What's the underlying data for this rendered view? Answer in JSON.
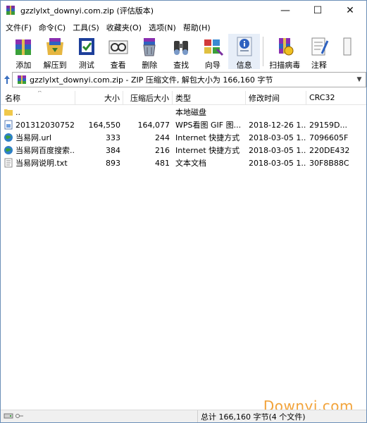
{
  "window": {
    "title": "gzzlylxt_downyi.com.zip (评估版本)",
    "controls": {
      "minimize": "—",
      "maximize": "☐",
      "close": "✕"
    }
  },
  "menu": [
    "文件(F)",
    "命令(C)",
    "工具(S)",
    "收藏夹(O)",
    "选项(N)",
    "帮助(H)"
  ],
  "toolbar": [
    {
      "label": "添加",
      "icon": "add-archive-icon"
    },
    {
      "label": "解压到",
      "icon": "extract-to-icon"
    },
    {
      "label": "测试",
      "icon": "test-icon"
    },
    {
      "label": "查看",
      "icon": "view-icon"
    },
    {
      "label": "删除",
      "icon": "delete-icon"
    },
    {
      "label": "查找",
      "icon": "find-icon"
    },
    {
      "label": "向导",
      "icon": "wizard-icon"
    },
    {
      "label": "信息",
      "icon": "info-icon"
    },
    {
      "label": "扫描病毒",
      "icon": "virus-scan-icon"
    },
    {
      "label": "注释",
      "icon": "comment-icon"
    }
  ],
  "address": {
    "text": "gzzlylxt_downyi.com.zip - ZIP 压缩文件, 解包大小为 166,160 字节"
  },
  "columns": {
    "name": "名称",
    "size": "大小",
    "packed": "压缩后大小",
    "type": "类型",
    "modified": "修改时间",
    "crc": "CRC32"
  },
  "files": [
    {
      "name": "..",
      "size": "",
      "packed": "",
      "type": "本地磁盘",
      "modified": "",
      "crc": "",
      "icon": "folder-up-icon"
    },
    {
      "name": "201312030752...",
      "size": "164,550",
      "packed": "164,077",
      "type": "WPS看图 GIF 图...",
      "modified": "2018-12-26 1...",
      "crc": "29159D...",
      "icon": "image-file-icon"
    },
    {
      "name": "当易网.url",
      "size": "333",
      "packed": "244",
      "type": "Internet 快捷方式",
      "modified": "2018-03-05 1...",
      "crc": "7096605F",
      "icon": "internet-shortcut-icon"
    },
    {
      "name": "当易网百度搜索....",
      "size": "384",
      "packed": "216",
      "type": "Internet 快捷方式",
      "modified": "2018-03-05 1...",
      "crc": "220DE432",
      "icon": "internet-shortcut-icon"
    },
    {
      "name": "当易网说明.txt",
      "size": "893",
      "packed": "481",
      "type": "文本文档",
      "modified": "2018-03-05 1...",
      "crc": "30F8B88C",
      "icon": "text-file-icon"
    }
  ],
  "status": {
    "text": "总计 166,160 字节(4 个文件)"
  },
  "watermark": "Downyi.com"
}
